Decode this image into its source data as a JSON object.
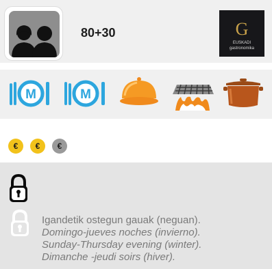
{
  "header": {
    "capacity": "80+30",
    "icon": "people-group-icon",
    "logo": {
      "icon": "euskadi-gastronomika-logo",
      "letter": "G",
      "line1": "EUSKADI",
      "line2": "gastronomika"
    }
  },
  "services": [
    {
      "icon": "menu-plate-icon",
      "letter": "M"
    },
    {
      "icon": "menu-plate-icon",
      "letter": "M"
    },
    {
      "icon": "catering-cloche-icon"
    },
    {
      "icon": "grill-icon"
    },
    {
      "icon": "cooking-pot-icon"
    }
  ],
  "price": {
    "level": 2,
    "max": 3,
    "symbol": "€",
    "active_color": "#f2c21b",
    "inactive_color": "#9a9a9a"
  },
  "schedule": {
    "closed_icon": "lock-icon",
    "lines": [
      "Igandetik ostegun gauak (neguan).",
      "Domingo-jueves noches (invierno).",
      "Sunday-Thursday evening (winter).",
      "Dimanche -jeudi soirs (hiver)."
    ]
  }
}
